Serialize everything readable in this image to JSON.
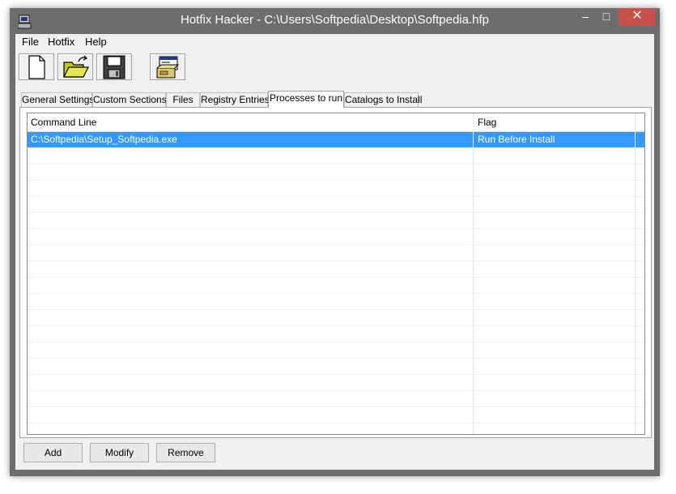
{
  "window": {
    "title": "Hotfix Hacker - C:\\Users\\Softpedia\\Desktop\\Softpedia.hfp",
    "minimize": "–",
    "maximize": "□",
    "close": "✕"
  },
  "menu": [
    "File",
    "Hotfix",
    "Help"
  ],
  "toolbar": {
    "icons": [
      "new-document-icon",
      "open-folder-icon",
      "save-disk-icon",
      "build-package-icon"
    ]
  },
  "tabs": [
    {
      "label": "General Settings",
      "active": false
    },
    {
      "label": "Custom Sections",
      "active": false
    },
    {
      "label": "Files",
      "active": false
    },
    {
      "label": "Registry Entries",
      "active": false
    },
    {
      "label": "Processes to run",
      "active": true
    },
    {
      "label": "Catalogs to Install",
      "active": false
    }
  ],
  "list": {
    "columns": [
      "Command Line",
      "Flag"
    ],
    "rows": [
      {
        "command": "C:\\Softpedia\\Setup_Softpedia.exe",
        "flag": "Run Before Install",
        "selected": true
      }
    ]
  },
  "buttons": {
    "add": "Add",
    "modify": "Modify",
    "remove": "Remove"
  },
  "colors": {
    "titlebar": "#6d6d6d",
    "close_button": "#c7504b",
    "selection": "#3399ff"
  }
}
